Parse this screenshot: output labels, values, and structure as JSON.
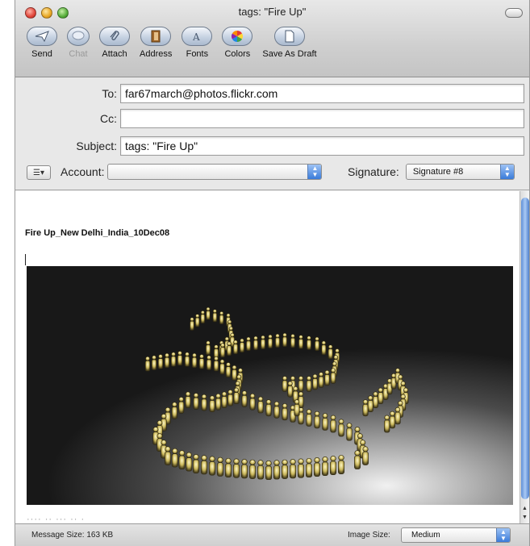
{
  "window": {
    "title": "tags: \"Fire Up\""
  },
  "toolbar": {
    "send": "Send",
    "chat": "Chat",
    "attach": "Attach",
    "address": "Address",
    "fonts": "Fonts",
    "colors": "Colors",
    "save_as_draft": "Save As Draft"
  },
  "header": {
    "to_label": "To:",
    "to_value": "far67march@photos.flickr.com",
    "cc_label": "Cc:",
    "cc_value": "",
    "subject_label": "Subject:",
    "subject_value": "tags: \"Fire Up\"",
    "account_label": "Account:",
    "account_value": "",
    "signature_label": "Signature:",
    "signature_value": "Signature #8"
  },
  "message": {
    "title": "Fire Up_New Delhi_India_10Dec08"
  },
  "status": {
    "message_size": "Message Size: 163 KB",
    "image_size_label": "Image Size:",
    "image_size_value": "Medium"
  },
  "colors": {
    "accent": "#3a7bd9",
    "close": "#e0453a",
    "minimize": "#e8a623",
    "zoom": "#56ad3a"
  }
}
